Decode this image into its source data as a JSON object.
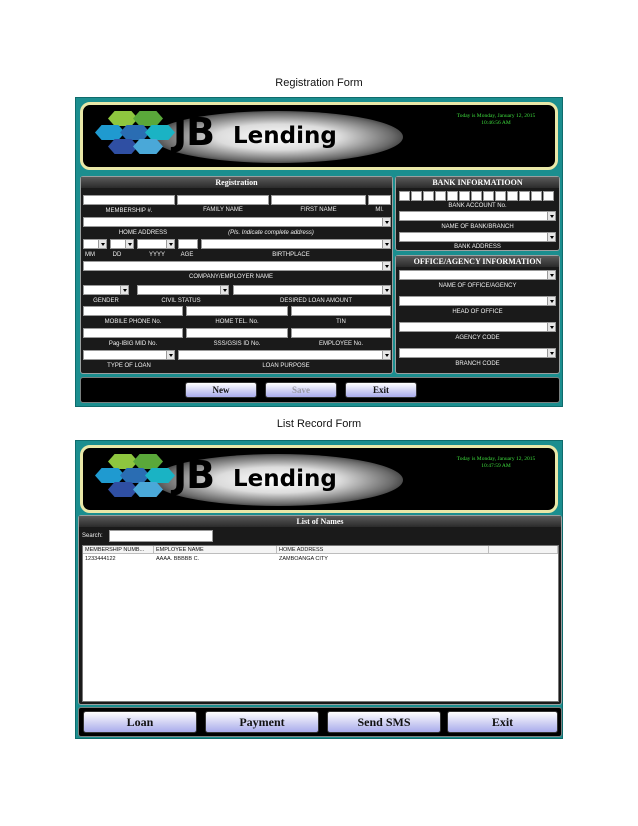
{
  "captions": {
    "registration": "Registration Form",
    "list": "List Record Form"
  },
  "brand": {
    "jb": "JB",
    "lending": "Lending"
  },
  "registration_form": {
    "datetime_line1": "Today is  Monday, January 12, 2015",
    "datetime_line2": "10:46:56 AM",
    "registration_panel": {
      "title": "Registration",
      "labels": {
        "membership_no": "MEMBERSHIP #.",
        "family_name": "FAMILY NAME",
        "first_name": "FIRST NAME",
        "mi": "MI.",
        "home_address": "HOME ADDRESS",
        "address_hint": "(Pls. Indicate complete address)",
        "mm": "MM",
        "dd": "DD",
        "yyyy": "YYYY",
        "age": "AGE",
        "birthplace": "BIRTHPLACE",
        "company_employer_name": "COMPANY/EMPLOYER NAME",
        "gender": "GENDER",
        "civil_status": "CIVIL STATUS",
        "desired_loan_amount": "DESIRED LOAN AMOUNT",
        "mobile_phone": "MOBILE PHONE No.",
        "home_tel": "HOME TEL. No.",
        "tin": "TIN",
        "pagibig": "Pag-IBIG MID No.",
        "sss_gsis": "SSS/GSIS ID No.",
        "employee_no": "EMPLOYEE No.",
        "type_of_loan": "TYPE OF LOAN",
        "loan_purpose": "LOAN PURPOSE"
      }
    },
    "bank_panel": {
      "title": "BANK INFORMATIOON",
      "labels": {
        "bank_account_no": "BANK ACCOUNT No.",
        "name_of_bank_branch": "NAME OF BANK/BRANCH",
        "bank_address": "BANK ADDRESS"
      }
    },
    "office_panel": {
      "title": "OFFICE/AGENCY INFORMATION",
      "labels": {
        "name_of_office_agency": "NAME OF OFFICE/AGENCY",
        "head_of_office": "HEAD OF OFFICE",
        "agency_code": "AGENCY CODE",
        "branch_code": "BRANCH CODE"
      }
    },
    "buttons": {
      "new": "New",
      "save": "Save",
      "exit": "Exit"
    }
  },
  "list_form": {
    "datetime_line1": "Today is  Monday, January 12, 2015",
    "datetime_line2": "10:47:59 AM",
    "panel_title": "List of Names",
    "search_label": "Search:",
    "search_value": "",
    "columns": [
      "MEMBERSHIP NUMB...",
      "EMPLOYEE NAME",
      "HOME ADDRESS",
      ""
    ],
    "rows": [
      {
        "membership": "1233444122",
        "employee": "AAAA. BBBBB C.",
        "address": "ZAMBOANGA CITY"
      }
    ],
    "buttons": {
      "loan": "Loan",
      "payment": "Payment",
      "send_sms": "Send SMS",
      "exit": "Exit"
    }
  },
  "colors": {
    "frame": "#1b8e8f",
    "header_border": "#e9e8a8",
    "datetime": "#3ddc3d",
    "button": "#a9acec"
  }
}
